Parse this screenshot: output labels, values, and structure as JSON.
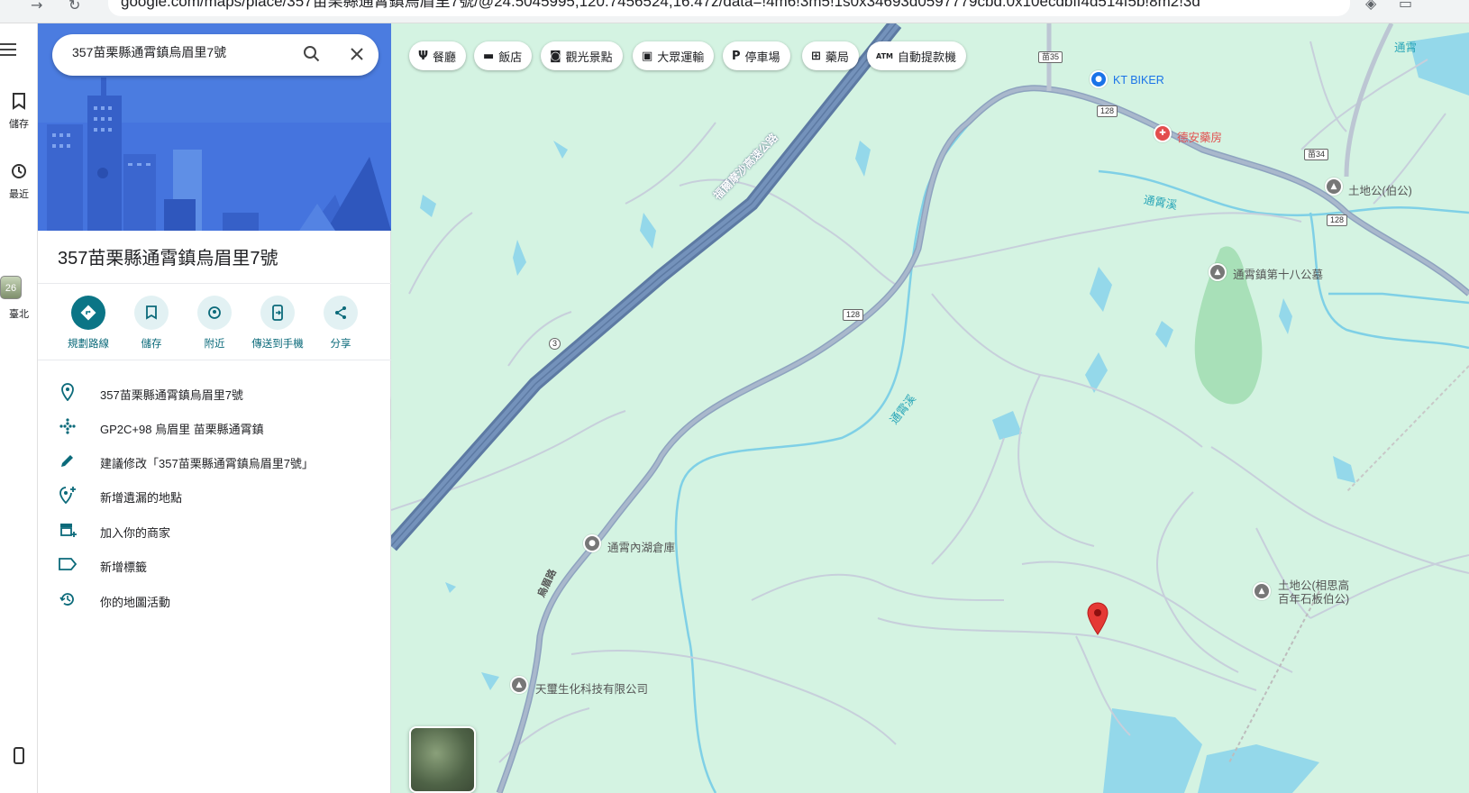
{
  "browser": {
    "url": "google.com/maps/place/357苗栗縣通霄鎮烏眉里7號/@24.5045995,120.7456524,16.47z/data=!4m6!3m5!1s0x34693d0597779cbd:0x10ecdbff4d514f5b!8m2!3d"
  },
  "rail": {
    "saved_label": "儲存",
    "recent_label": "最近",
    "thumb_label": "臺北",
    "thumb_badge": "26"
  },
  "search": {
    "value": "357苗栗縣通霄鎮烏眉里7號"
  },
  "place": {
    "title": "357苗栗縣通霄鎮烏眉里7號"
  },
  "actions": [
    {
      "label": "規劃路線"
    },
    {
      "label": "儲存"
    },
    {
      "label": "附近"
    },
    {
      "label": "傳送到手機"
    },
    {
      "label": "分享"
    }
  ],
  "details": [
    {
      "icon": "pin-outline-icon",
      "text": "357苗栗縣通霄鎮烏眉里7號"
    },
    {
      "icon": "plus-code-icon",
      "text": "GP2C+98 烏眉里 苗栗縣通霄鎮"
    },
    {
      "icon": "pencil-icon",
      "text": "建議修改「357苗栗縣通霄鎮烏眉里7號」"
    },
    {
      "icon": "add-place-icon",
      "text": "新增遺漏的地點"
    },
    {
      "icon": "add-business-icon",
      "text": "加入你的商家"
    },
    {
      "icon": "label-icon",
      "text": "新增標籤"
    },
    {
      "icon": "history-icon",
      "text": "你的地圖活動"
    }
  ],
  "chips": [
    {
      "icon": "restaurant-icon",
      "glyph": "Ψ",
      "label": "餐廳"
    },
    {
      "icon": "hotel-icon",
      "glyph": "▬",
      "label": "飯店"
    },
    {
      "icon": "camera-icon",
      "glyph": "◙",
      "label": "觀光景點"
    },
    {
      "icon": "transit-icon",
      "glyph": "▣",
      "label": "大眾運輸"
    },
    {
      "icon": "parking-icon",
      "glyph": "P",
      "label": "停車場"
    },
    {
      "icon": "pharmacy-icon",
      "glyph": "⊞",
      "label": "藥局"
    },
    {
      "icon": "atm-icon",
      "glyph": "ATM",
      "label": "自動提款機"
    }
  ],
  "map": {
    "highway_name": "福爾摩沙高速公路",
    "road_label": "烏眉路",
    "stream_label": "通霄溪",
    "shields": [
      "苗35",
      "128",
      "苗34",
      "128",
      "128",
      "3"
    ],
    "places": [
      {
        "name": "KT BIKER",
        "kind": "shop",
        "color": "#1a73e8"
      },
      {
        "name": "德安藥房",
        "kind": "pharmacy",
        "color": "#e34d4d"
      },
      {
        "name": "土地公(伯公)",
        "kind": "temple",
        "color": "#777777"
      },
      {
        "name": "通霄鎮第十八公墓",
        "kind": "cemetery",
        "color": "#777777"
      },
      {
        "name": "通霄內湖倉庫",
        "kind": "warehouse",
        "color": "#777777"
      },
      {
        "name": "天璽生化科技有限公司",
        "kind": "company",
        "color": "#777777"
      },
      {
        "name": "土地公(相思高\n百年石板伯公)",
        "kind": "temple",
        "color": "#777777"
      }
    ],
    "edge_label_top_right": "通霄",
    "colors": {
      "land": "#d4f3e2",
      "water": "#94d8ea",
      "park": "#a8e0b8",
      "highway": "#6a8ab5",
      "road": "#a5b5c8",
      "marker": "#e53935"
    }
  }
}
